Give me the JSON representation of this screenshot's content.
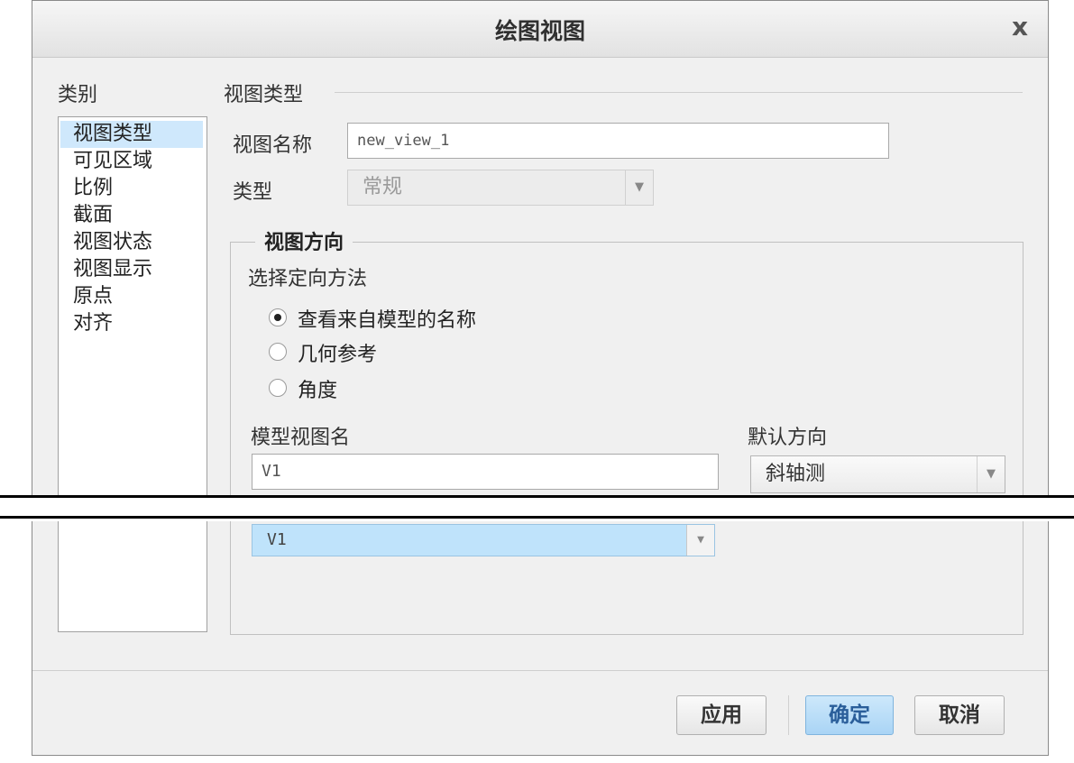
{
  "window": {
    "title": "绘图视图",
    "close_glyph": "x"
  },
  "sidebar": {
    "heading": "类别",
    "items": [
      {
        "label": "视图类型",
        "selected": true
      },
      {
        "label": "可见区域"
      },
      {
        "label": "比例"
      },
      {
        "label": "截面"
      },
      {
        "label": "视图状态"
      },
      {
        "label": "视图显示"
      },
      {
        "label": "原点"
      },
      {
        "label": "对齐"
      }
    ]
  },
  "main": {
    "section_title": "视图类型",
    "view_name_label": "视图名称",
    "view_name_value": "new_view_1",
    "type_label": "类型",
    "type_value": "常规"
  },
  "orientation": {
    "group_title": "视图方向",
    "method_label": "选择定向方法",
    "options": [
      {
        "label": "查看来自模型的名称",
        "checked": true
      },
      {
        "label": "几何参考",
        "checked": false
      },
      {
        "label": "角度",
        "checked": false
      }
    ],
    "model_view_label": "模型视图名",
    "model_view_value": "V1",
    "default_dir_label": "默认方向",
    "default_dir_value": "斜轴测",
    "model_view_select_value": "V1"
  },
  "buttons": {
    "apply": "应用",
    "ok": "确定",
    "cancel": "取消"
  },
  "colors": {
    "selection": "#cfe8fc",
    "primary_button": "#a9d4f5",
    "list_selected": "#b9e2fb"
  }
}
